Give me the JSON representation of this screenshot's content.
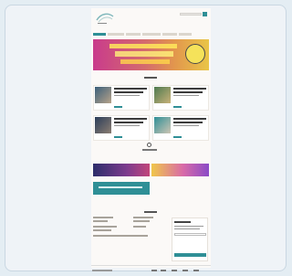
{
  "colors": {
    "background": "#e4edf3",
    "accent": "#2f8f96",
    "page": "#fbf9f7",
    "banner_start": "#c93b8c",
    "banner_end": "#e9c547"
  },
  "icons": [
    "logo-icon",
    "search-icon",
    "more-icon"
  ],
  "nav": {
    "item_count": 6
  },
  "news": {
    "item_count": 4
  },
  "social": {
    "item_count": 5
  }
}
